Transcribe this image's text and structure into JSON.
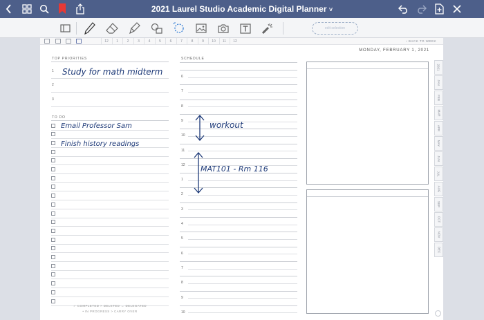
{
  "window": {
    "title": "2021 Laurel Studio Academic Digital Planner",
    "title_chevron": "˅",
    "colors": {
      "topbar": "#4d5f8a",
      "ink": "#1e3a78",
      "bookmark": "#e53935"
    }
  },
  "topbar_icons": [
    "back-chevron-icon",
    "thumbnail-grid-icon",
    "search-icon",
    "bookmark-icon",
    "share-icon",
    "undo-icon",
    "redo-icon",
    "add-page-icon",
    "close-icon"
  ],
  "toolbar_icons": [
    "notebook-icon",
    "pen-icon",
    "eraser-icon",
    "highlighter-icon",
    "shapes-icon",
    "lasso-icon",
    "image-icon",
    "camera-icon",
    "text-tool-icon",
    "laser-pointer-icon"
  ],
  "lasso_pill": "edit selection",
  "pagebar": {
    "hours": [
      "12",
      "1",
      "2",
      "3",
      "4",
      "5",
      "6",
      "7",
      "8",
      "9",
      "10",
      "11",
      "12"
    ],
    "back_label": "‹ BACK TO WEEK"
  },
  "planner": {
    "date": "MONDAY, FEBRUARY 1, 2021",
    "top_priorities_label": "TOP PRIORITIES",
    "priority_numbers": [
      "1",
      "2",
      "3"
    ],
    "priorities": [
      "Study for math midterm",
      "",
      ""
    ],
    "todo_label": "TO DO",
    "todos": [
      "Email Professor Sam",
      "Finish history readings"
    ],
    "schedule_label": "SCHEDULE",
    "schedule_hours": [
      "6",
      "7",
      "8",
      "9",
      "10",
      "11",
      "12",
      "1",
      "2",
      "3",
      "4",
      "5",
      "6",
      "7",
      "8",
      "9",
      "10"
    ],
    "schedule_notes": [
      "workout",
      "MAT101 - Rm 116"
    ],
    "legend_line1": "✓ COMPLETED   × DELETED   → DELEGATED",
    "legend_line2": "• IN PROGRESS   > CARRY OVER"
  },
  "month_tabs": [
    "2021",
    "JAN",
    "FEB",
    "MAR",
    "APR",
    "MAY",
    "JUN",
    "JUL",
    "AUG",
    "SEP",
    "OCT",
    "NOV",
    "DEC"
  ]
}
